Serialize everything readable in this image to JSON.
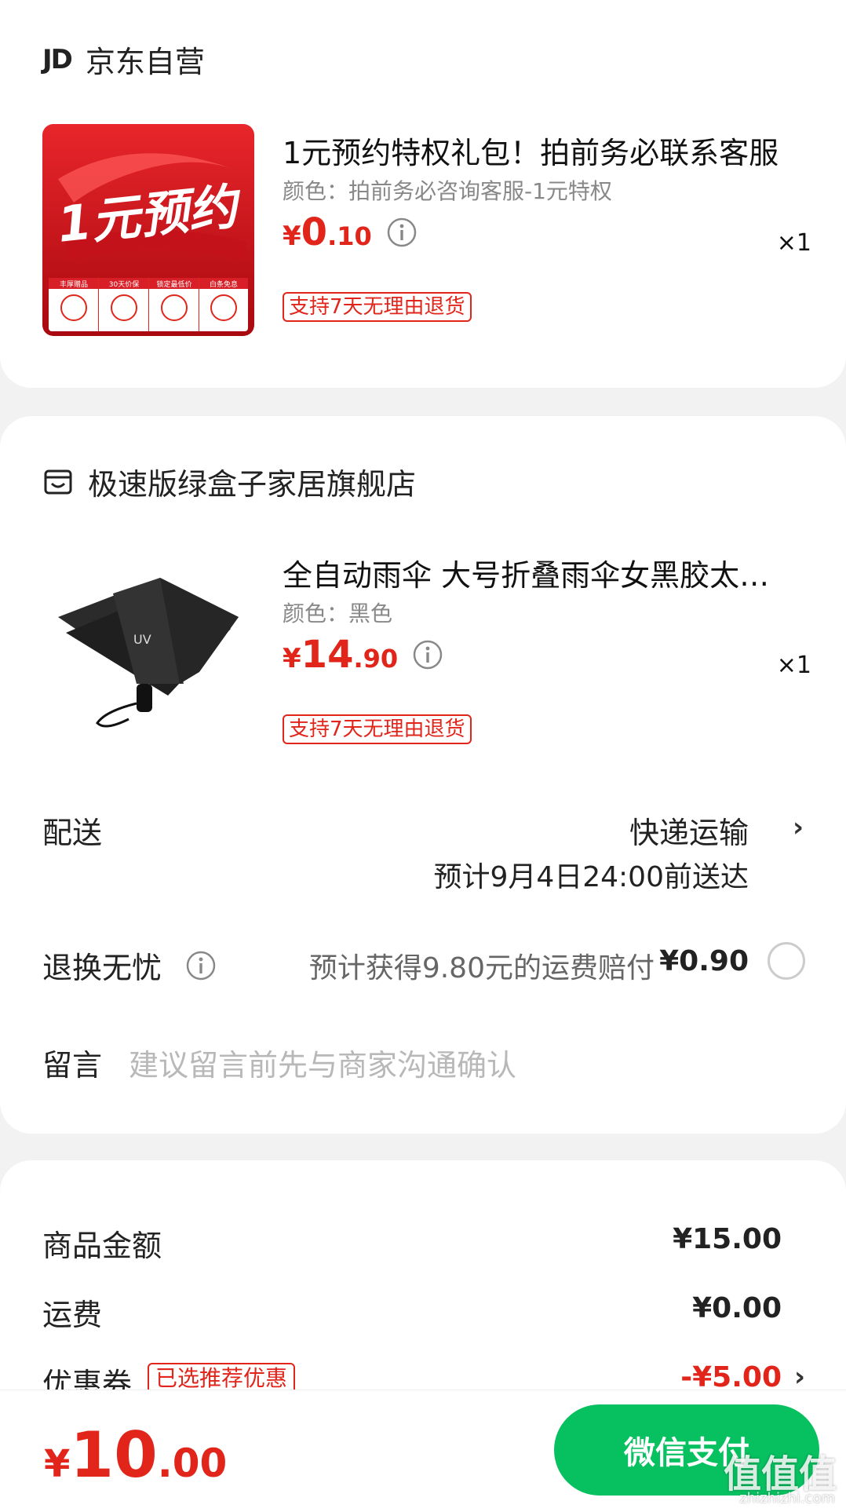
{
  "store1": {
    "logo": "JD",
    "name": "京东自营",
    "product": {
      "title": "1元预约特权礼包！拍前务必联系客服",
      "spec": "颜色：拍前务必咨询客服-1元特权",
      "price_currency": "¥",
      "price_int": "0",
      "price_dec": ".10",
      "qty": "×1",
      "return_tag": "支持7天无理由退货",
      "thumb_headline": "1元预约",
      "thumb_badges": [
        "丰厚赠品",
        "30天价保",
        "锁定最低价",
        "白条免息"
      ]
    }
  },
  "store2": {
    "name": "极速版绿盒子家居旗舰店",
    "product": {
      "title": "全自动雨伞 大号折叠雨伞女黑胶太阳伞",
      "spec": "颜色：黑色",
      "price_currency": "¥",
      "price_int": "14",
      "price_dec": ".90",
      "qty": "×1",
      "return_tag": "支持7天无理由退货",
      "umbrella_label": "UV"
    }
  },
  "delivery": {
    "label": "配送",
    "method": "快递运输",
    "eta": "预计9月4日24:00前送达"
  },
  "refund": {
    "label": "退换无忧",
    "desc": "预计获得9.80元的运费赔付",
    "price": "¥0.90"
  },
  "note": {
    "label": "留言",
    "placeholder": "建议留言前先与商家沟通确认"
  },
  "summary": {
    "goods_label": "商品金额",
    "goods_value": "¥15.00",
    "shipping_label": "运费",
    "shipping_value": "¥0.00",
    "coupon_label": "优惠券",
    "coupon_tag": "已选推荐优惠",
    "coupon_value": "-¥5.00"
  },
  "bottom": {
    "total_currency": "¥",
    "total_int": "10",
    "total_dec": ".00",
    "pay_label": "微信支付"
  },
  "watermark": {
    "text": "值值值",
    "sub": "zhizhizhi.com"
  },
  "colors": {
    "accent_red": "#e1251b",
    "pay_green": "#07c160"
  }
}
